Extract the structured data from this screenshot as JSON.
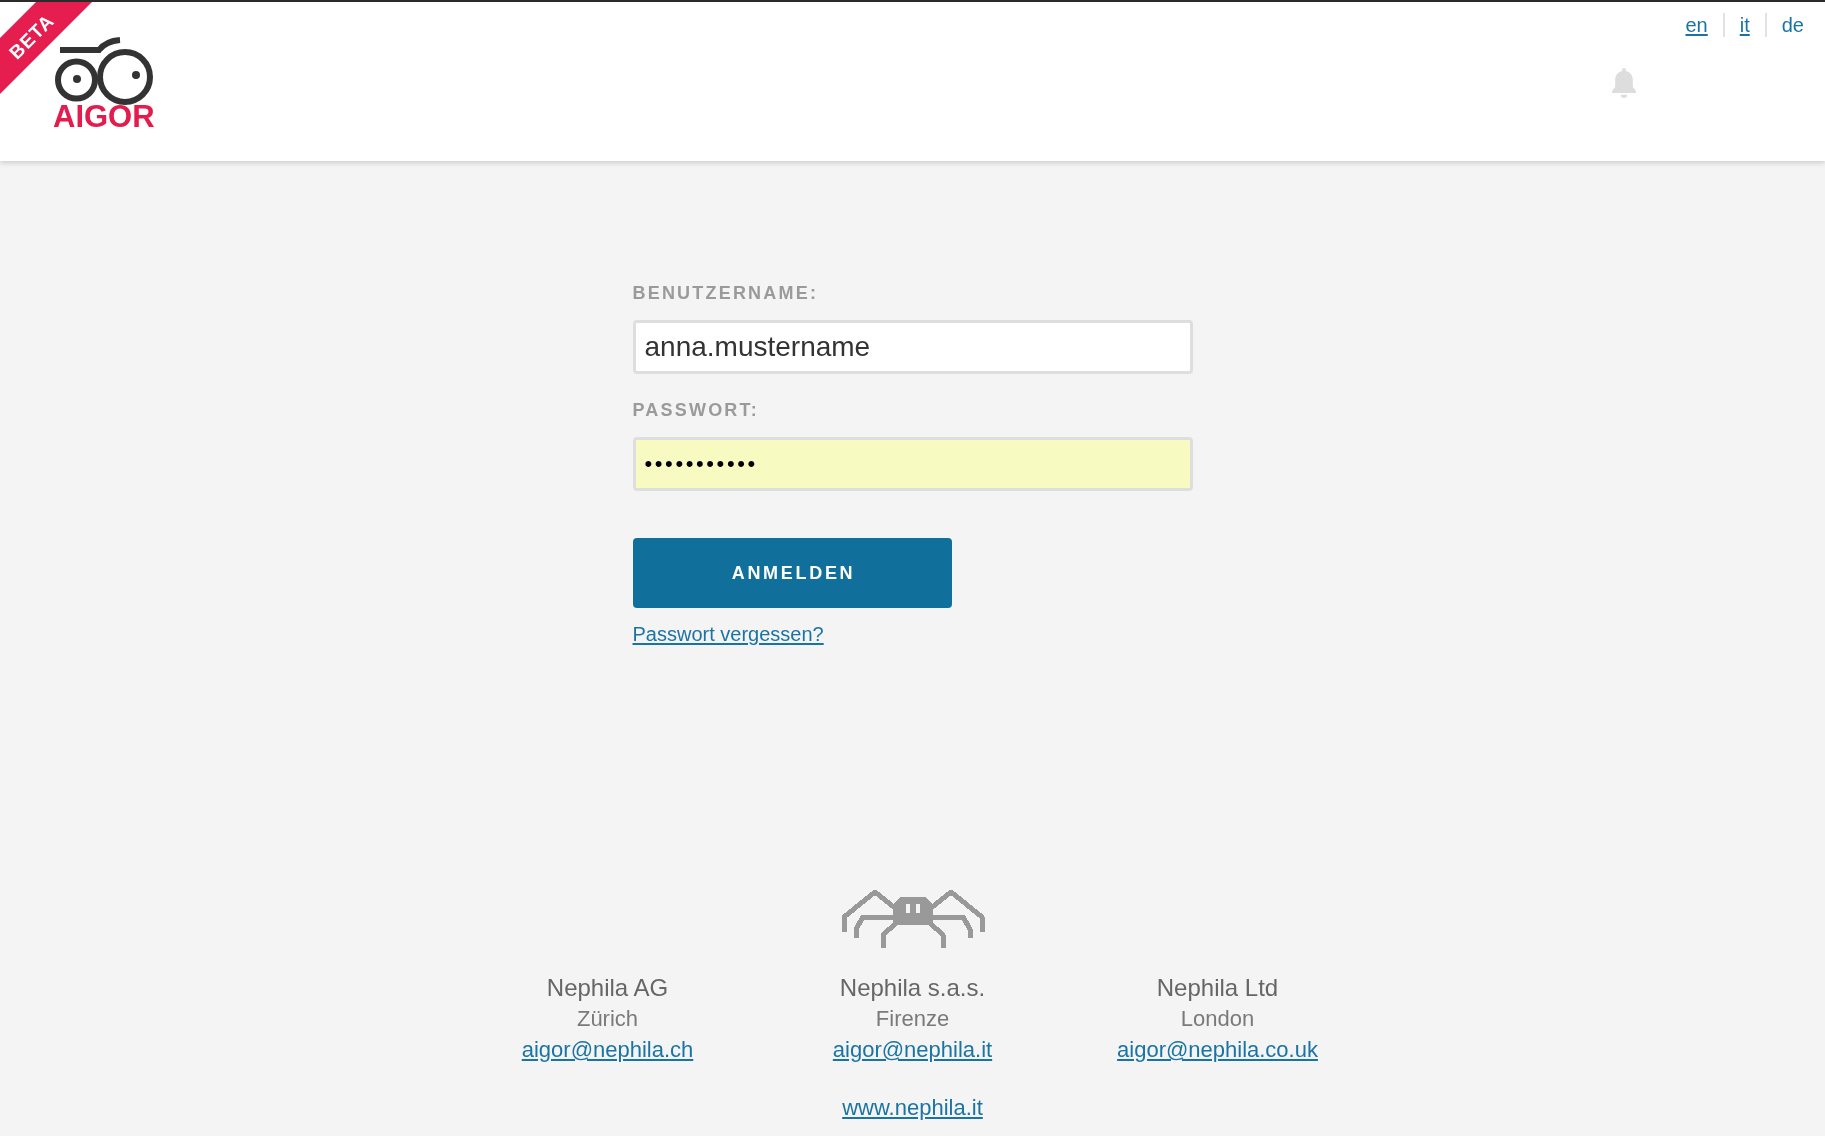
{
  "header": {
    "ribbon": "BETA",
    "logo_text": "AIGOR",
    "languages": [
      {
        "label": "en",
        "selected": false
      },
      {
        "label": "it",
        "selected": false
      },
      {
        "label": "de",
        "selected": true
      }
    ]
  },
  "login_form": {
    "username": {
      "label": "BENUTZERNAME:",
      "value": "anna.mustername",
      "autofilled": false
    },
    "password": {
      "label": "PASSWORT:",
      "value": "•••••••••••",
      "autofilled": true
    },
    "submit_button": "ANMELDEN",
    "forgot_password_link": "Passwort vergessen?"
  },
  "footer": {
    "offices": [
      {
        "company": "Nephila AG",
        "city": "Zürich",
        "email": "aigor@nephila.ch"
      },
      {
        "company": "Nephila s.a.s.",
        "city": "Firenze",
        "email": "aigor@nephila.it"
      },
      {
        "company": "Nephila Ltd",
        "city": "London",
        "email": "aigor@nephila.co.uk"
      }
    ],
    "website": "www.nephila.it"
  }
}
